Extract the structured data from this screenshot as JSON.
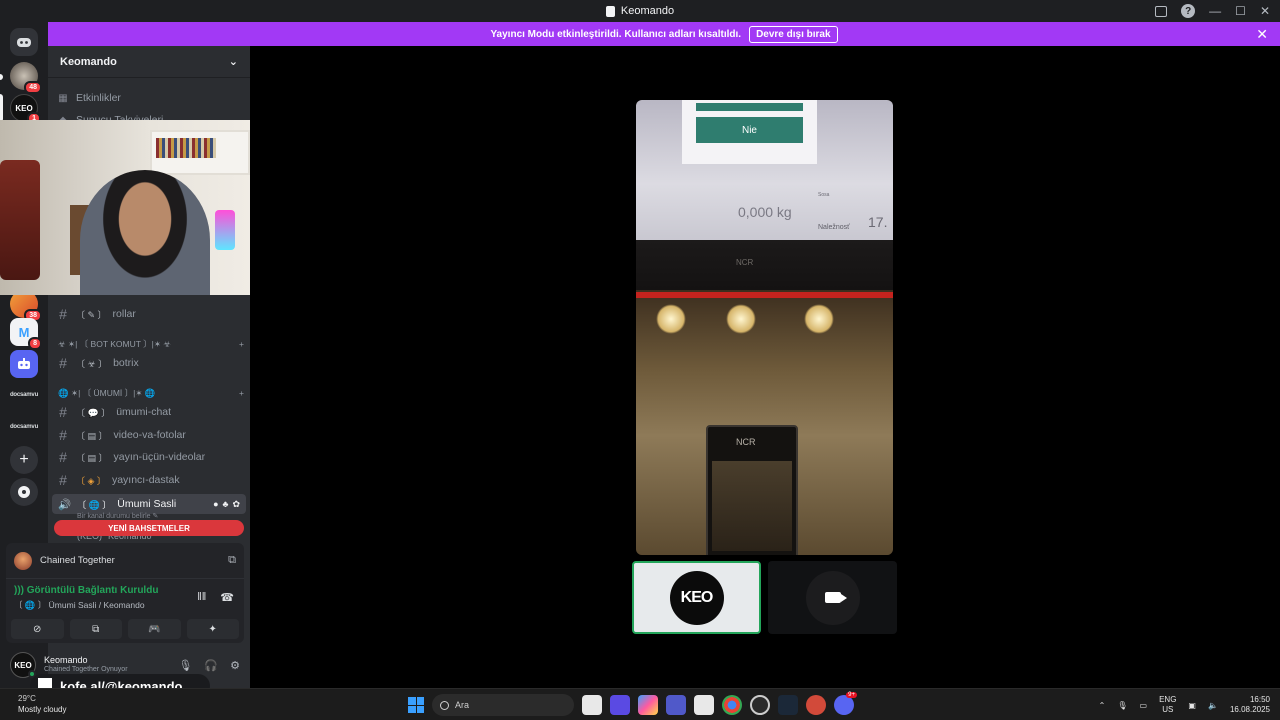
{
  "window": {
    "title": "Keomando"
  },
  "banner": {
    "text": "Yayıncı Modu etkinleştirildi. Kullanıcı adları kısaltıldı.",
    "button": "Devre dışı bırak"
  },
  "rail": {
    "badges": [
      "48",
      "1",
      "38",
      "8"
    ],
    "labels": [
      "docsamvu",
      "docsamvu"
    ]
  },
  "sidebar": {
    "server_name": "Keomando",
    "top_items": [
      {
        "label": "Etkinlikler"
      },
      {
        "label": "Sunucu Takviyeleri"
      }
    ],
    "channels_top": [
      {
        "label": "rollar"
      }
    ],
    "categories": [
      {
        "label": "☣ ✶| 〔 BOT KOMUT 〕|✶ ☣"
      },
      {
        "label": "🌐 ✶| 〔 ÜMUMİ 〕|✶ 🌐"
      }
    ],
    "bot_channels": [
      {
        "label": "botrix"
      }
    ],
    "general_channels": [
      {
        "label": "ümumi-chat"
      },
      {
        "label": "video-va-fotolar"
      },
      {
        "label": "yayın-üçün-videolar"
      },
      {
        "label": "yayıncı-dastak"
      }
    ],
    "voice_channel": {
      "label": "Ümumi Sasli",
      "status_hint": "Bir kanal durumu belirle"
    },
    "mentions_pill": "YENİ BAHSETMELER",
    "voice_user": "Keomando"
  },
  "voice_panel": {
    "activity": "Chained Together",
    "connection_status": "Görüntülü Bağlantı Kuruldu",
    "channel_path": "〔 🌐 〕 Ümumi Sasli / Keomando"
  },
  "user_panel": {
    "avatar_text": "KEO",
    "username": "Keomando",
    "status": "Chained Together Oynuyor"
  },
  "stream": {
    "screen_button": "Nie",
    "weight": "0,000 kg",
    "side_lines": [
      "",
      "Sosa"
    ],
    "label": "Naležnosť",
    "number": "17.",
    "brand": "NCR",
    "tile_logo": "KEO"
  },
  "overlay": {
    "kofe": "kofe.al/@keomando"
  },
  "taskbar": {
    "weather_temp": "29°C",
    "weather_desc": "Mostly cloudy",
    "search_placeholder": "Ara",
    "lang_top": "ENG",
    "lang_bottom": "US",
    "time": "16:50",
    "date": "16.08.2025",
    "discord_badge": "9+"
  },
  "colors": {
    "banner": "#a239f5",
    "accent_green": "#23a55a",
    "mention_red": "#da373c"
  }
}
